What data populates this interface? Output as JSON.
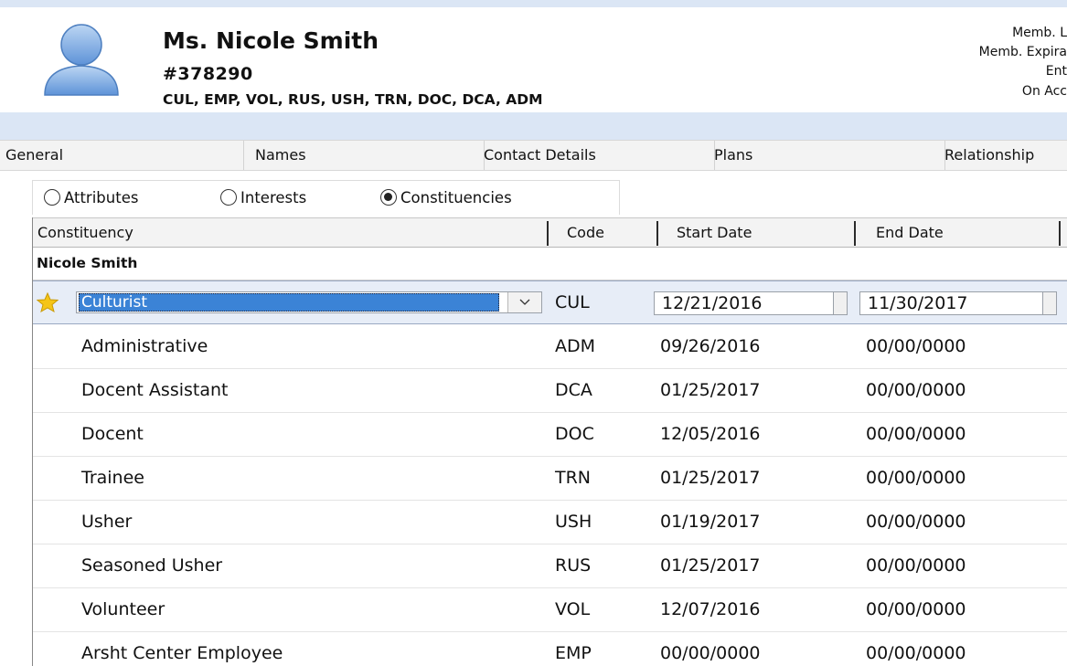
{
  "member": {
    "name": "Ms. Nicole Smith",
    "number": "#378290",
    "constituency_codes": "CUL, EMP, VOL, RUS, USH, TRN, DOC, DCA, ADM",
    "info_lines": [
      "Memb. L",
      "Memb. Expira",
      "Ent",
      "On Acc"
    ],
    "avatar_icon": "person-silhouette-icon"
  },
  "tabs": [
    {
      "label": "General"
    },
    {
      "label": "Names"
    },
    {
      "label": "Contact Details"
    },
    {
      "label": "Plans"
    },
    {
      "label": "Relationship"
    }
  ],
  "view_options": {
    "attributes": "Attributes",
    "interests": "Interests",
    "constituencies": "Constituencies",
    "selected": "constituencies"
  },
  "grid": {
    "columns": [
      "Constituency",
      "Code",
      "Start Date",
      "End Date"
    ],
    "group_label": "Nicole Smith",
    "selected_row": {
      "icon": "star-icon",
      "constituency": "Culturist",
      "code": "CUL",
      "start_date": "12/21/2016",
      "end_date": "11/30/2017"
    },
    "rows": [
      {
        "constituency": "Administrative",
        "code": "ADM",
        "start_date": "09/26/2016",
        "end_date": "00/00/0000"
      },
      {
        "constituency": "Docent Assistant",
        "code": "DCA",
        "start_date": "01/25/2017",
        "end_date": "00/00/0000"
      },
      {
        "constituency": "Docent",
        "code": "DOC",
        "start_date": "12/05/2016",
        "end_date": "00/00/0000"
      },
      {
        "constituency": "Trainee",
        "code": "TRN",
        "start_date": "01/25/2017",
        "end_date": "00/00/0000"
      },
      {
        "constituency": "Usher",
        "code": "USH",
        "start_date": "01/19/2017",
        "end_date": "00/00/0000"
      },
      {
        "constituency": "Seasoned Usher",
        "code": "RUS",
        "start_date": "01/25/2017",
        "end_date": "00/00/0000"
      },
      {
        "constituency": "Volunteer",
        "code": "VOL",
        "start_date": "12/07/2016",
        "end_date": "00/00/0000"
      },
      {
        "constituency": "Arsht Center Employee",
        "code": "EMP",
        "start_date": "00/00/0000",
        "end_date": "00/00/0000"
      }
    ]
  },
  "colors": {
    "header_band": "#dbe6f5",
    "selection_highlight": "#3b83d6",
    "selected_row_bg": "#e7edf7",
    "star": "#f5c518"
  }
}
